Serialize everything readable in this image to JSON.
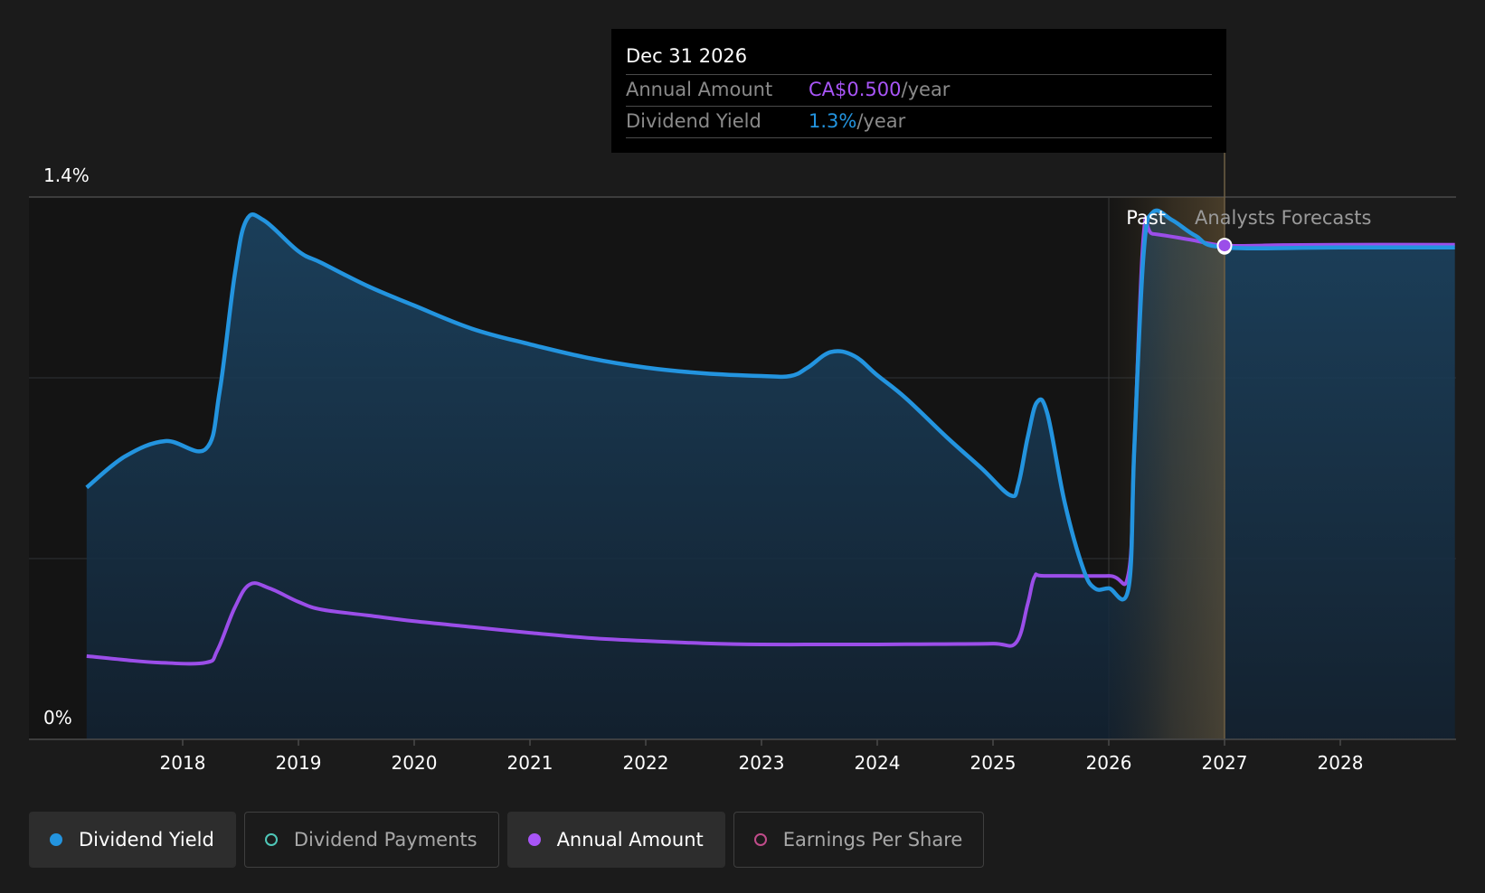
{
  "chart_data": {
    "type": "area",
    "x_ticks": [
      "2018",
      "2019",
      "2020",
      "2021",
      "2022",
      "2023",
      "2024",
      "2025",
      "2026",
      "2027",
      "2028"
    ],
    "y_axis": {
      "top_label": "1.4%",
      "bottom_label": "0%",
      "min": 0,
      "max": 1.4
    },
    "series": [
      {
        "name": "Dividend Yield",
        "color": "#2394df",
        "points": [
          [
            2017.17,
            0.65
          ],
          [
            2017.5,
            0.73
          ],
          [
            2017.85,
            0.77
          ],
          [
            2018.2,
            0.75
          ],
          [
            2018.32,
            0.9
          ],
          [
            2018.45,
            1.2
          ],
          [
            2018.55,
            1.34
          ],
          [
            2018.7,
            1.34
          ],
          [
            2019.0,
            1.26
          ],
          [
            2019.2,
            1.23
          ],
          [
            2019.6,
            1.17
          ],
          [
            2020.0,
            1.12
          ],
          [
            2020.5,
            1.06
          ],
          [
            2021.0,
            1.02
          ],
          [
            2021.5,
            0.985
          ],
          [
            2022.0,
            0.96
          ],
          [
            2022.5,
            0.945
          ],
          [
            2023.0,
            0.938
          ],
          [
            2023.25,
            0.938
          ],
          [
            2023.4,
            0.96
          ],
          [
            2023.6,
            1.0
          ],
          [
            2023.8,
            0.99
          ],
          [
            2024.0,
            0.94
          ],
          [
            2024.25,
            0.88
          ],
          [
            2024.6,
            0.78
          ],
          [
            2024.9,
            0.7
          ],
          [
            2025.15,
            0.63
          ],
          [
            2025.22,
            0.66
          ],
          [
            2025.3,
            0.78
          ],
          [
            2025.38,
            0.87
          ],
          [
            2025.47,
            0.84
          ],
          [
            2025.62,
            0.61
          ],
          [
            2025.78,
            0.44
          ],
          [
            2025.88,
            0.39
          ],
          [
            2026.0,
            0.39
          ],
          [
            2026.17,
            0.39
          ],
          [
            2026.22,
            0.75
          ],
          [
            2026.3,
            1.25
          ],
          [
            2026.38,
            1.36
          ],
          [
            2026.55,
            1.34
          ],
          [
            2026.75,
            1.3
          ],
          [
            2027.0,
            1.27
          ],
          [
            2028.0,
            1.27
          ],
          [
            2028.99,
            1.27
          ]
        ]
      },
      {
        "name": "Annual Amount",
        "color": "#9b4ee9",
        "points": [
          [
            2017.17,
            0.215
          ],
          [
            2017.5,
            0.205
          ],
          [
            2017.8,
            0.198
          ],
          [
            2018.2,
            0.198
          ],
          [
            2018.3,
            0.23
          ],
          [
            2018.45,
            0.34
          ],
          [
            2018.58,
            0.4
          ],
          [
            2018.75,
            0.39
          ],
          [
            2019.0,
            0.355
          ],
          [
            2019.2,
            0.335
          ],
          [
            2019.6,
            0.32
          ],
          [
            2020.0,
            0.305
          ],
          [
            2020.5,
            0.29
          ],
          [
            2021.0,
            0.275
          ],
          [
            2021.5,
            0.262
          ],
          [
            2022.0,
            0.254
          ],
          [
            2022.5,
            0.248
          ],
          [
            2023.0,
            0.245
          ],
          [
            2023.5,
            0.245
          ],
          [
            2024.0,
            0.245
          ],
          [
            2024.5,
            0.246
          ],
          [
            2025.0,
            0.247
          ],
          [
            2025.2,
            0.25
          ],
          [
            2025.3,
            0.35
          ],
          [
            2025.36,
            0.42
          ],
          [
            2025.45,
            0.422
          ],
          [
            2026.0,
            0.422
          ],
          [
            2026.17,
            0.428
          ],
          [
            2026.22,
            0.75
          ],
          [
            2026.3,
            1.3
          ],
          [
            2026.38,
            1.305
          ],
          [
            2026.7,
            1.29
          ],
          [
            2027.0,
            1.275
          ],
          [
            2027.5,
            1.276
          ],
          [
            2028.0,
            1.277
          ],
          [
            2028.99,
            1.277
          ]
        ]
      }
    ],
    "past_label": "Past",
    "forecast_label": "Analysts Forecasts",
    "past_boundary_x": 2027.0,
    "tooltip": {
      "date": "Dec 31 2026",
      "rows": [
        {
          "label": "Annual Amount",
          "value": "CA$0.500",
          "suffix": "/year",
          "color": "#a855f7"
        },
        {
          "label": "Dividend Yield",
          "value": "1.3%",
          "suffix": "/year",
          "color": "#2394df"
        }
      ]
    }
  },
  "legend": [
    {
      "label": "Dividend Yield",
      "color": "#2394df",
      "active": true
    },
    {
      "label": "Dividend Payments",
      "color": "#4fc7b8",
      "active": false
    },
    {
      "label": "Annual Amount",
      "color": "#a855f7",
      "active": true
    },
    {
      "label": "Earnings Per Share",
      "color": "#c04c8a",
      "active": false
    }
  ]
}
